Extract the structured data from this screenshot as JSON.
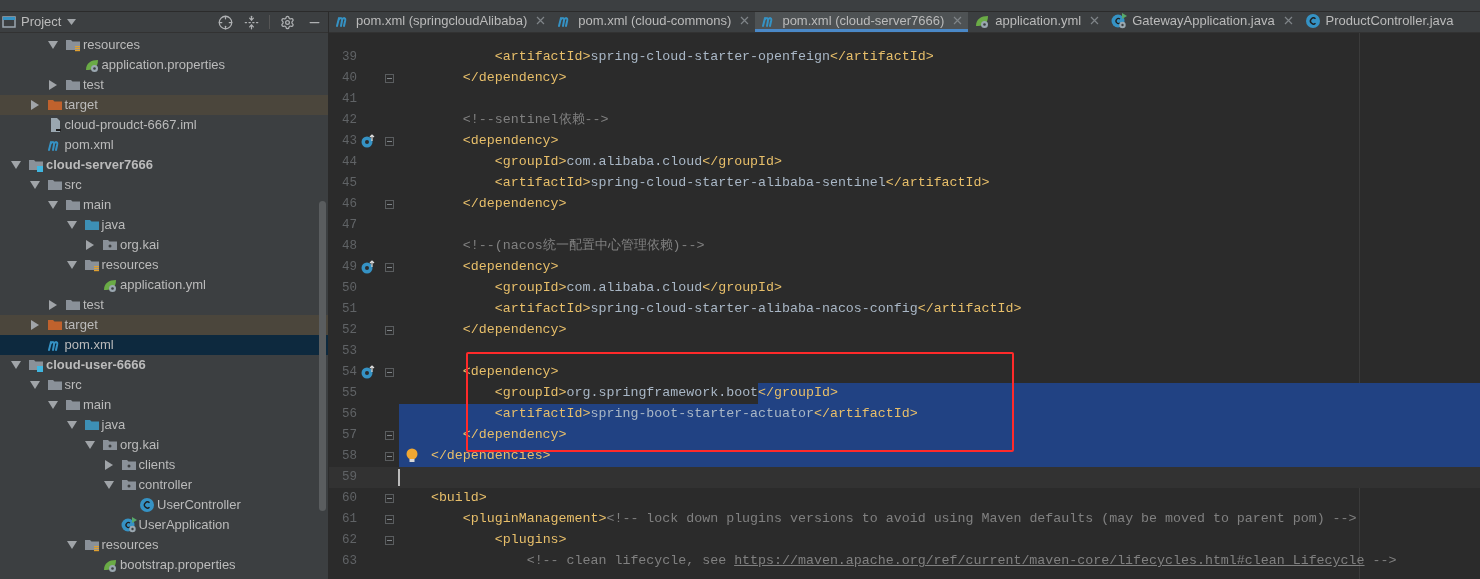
{
  "sidebar": {
    "title": "Project",
    "tree": [
      {
        "children": [
          {
            "children": [
              {
                "label": "resources",
                "kind": "resources-folder",
                "expanded": true,
                "selected": false,
                "children": [
                  {
                    "label": "application.properties",
                    "kind": "spring-config",
                    "selected": false
                  }
                ]
              },
              {
                "label": "test",
                "kind": "folder",
                "expanded": false,
                "selected": false
              }
            ]
          },
          {
            "label": "target",
            "kind": "excluded-folder",
            "expanded": false,
            "selected": false
          },
          {
            "label": "cloud-proudct-6667.iml",
            "kind": "iml-file",
            "selected": false
          },
          {
            "label": "pom.xml",
            "kind": "maven",
            "selected": false
          }
        ]
      },
      {
        "label": "cloud-server7666",
        "kind": "module",
        "expanded": true,
        "selected": false,
        "children": [
          {
            "label": "src",
            "kind": "folder",
            "expanded": true,
            "selected": false,
            "children": [
              {
                "label": "main",
                "kind": "folder",
                "expanded": true,
                "selected": false,
                "children": [
                  {
                    "label": "java",
                    "kind": "source-folder",
                    "expanded": true,
                    "selected": false,
                    "children": [
                      {
                        "label": "org.kai",
                        "kind": "package",
                        "expanded": false,
                        "selected": false
                      }
                    ]
                  },
                  {
                    "label": "resources",
                    "kind": "resources-folder",
                    "expanded": true,
                    "selected": false,
                    "children": [
                      {
                        "label": "application.yml",
                        "kind": "spring-config",
                        "selected": false
                      }
                    ]
                  }
                ]
              },
              {
                "label": "test",
                "kind": "folder",
                "expanded": false,
                "selected": false
              }
            ]
          },
          {
            "label": "target",
            "kind": "excluded-folder",
            "expanded": false,
            "selected": false
          },
          {
            "label": "pom.xml",
            "kind": "maven",
            "selected": true
          }
        ]
      },
      {
        "label": "cloud-user-6666",
        "kind": "module",
        "expanded": true,
        "selected": false,
        "children": [
          {
            "label": "src",
            "kind": "folder",
            "expanded": true,
            "selected": false,
            "children": [
              {
                "label": "main",
                "kind": "folder",
                "expanded": true,
                "selected": false,
                "children": [
                  {
                    "label": "java",
                    "kind": "source-folder",
                    "expanded": true,
                    "selected": false,
                    "children": [
                      {
                        "label": "org.kai",
                        "kind": "package",
                        "expanded": true,
                        "selected": false,
                        "children": [
                          {
                            "label": "clients",
                            "kind": "package",
                            "expanded": false,
                            "selected": false
                          },
                          {
                            "label": "controller",
                            "kind": "package",
                            "expanded": true,
                            "selected": false,
                            "children": [
                              {
                                "label": "UserController",
                                "kind": "class",
                                "selected": false
                              }
                            ]
                          },
                          {
                            "label": "UserApplication",
                            "kind": "boot-app",
                            "selected": false
                          }
                        ]
                      }
                    ]
                  },
                  {
                    "label": "resources",
                    "kind": "resources-folder",
                    "expanded": true,
                    "selected": false,
                    "children": [
                      {
                        "label": "bootstrap.properties",
                        "kind": "spring-config",
                        "selected": false
                      }
                    ]
                  }
                ]
              }
            ]
          }
        ]
      }
    ]
  },
  "tabs": [
    {
      "label": "pom.xml (springcloudAlibaba)",
      "kind": "maven",
      "selected": false,
      "closable": true
    },
    {
      "label": "pom.xml (cloud-commons)",
      "kind": "maven",
      "selected": false,
      "closable": true
    },
    {
      "label": "pom.xml (cloud-server7666)",
      "kind": "maven",
      "selected": true,
      "closable": true
    },
    {
      "label": "application.yml",
      "kind": "spring-config",
      "selected": false,
      "closable": true
    },
    {
      "label": "GatewayApplication.java",
      "kind": "boot-app",
      "selected": false,
      "closable": true
    },
    {
      "label": "ProductController.java",
      "kind": "class",
      "selected": false,
      "closable": false
    }
  ],
  "editor": {
    "lines": [
      {
        "number": "39",
        "text": "            <artifactId>spring-cloud-starter-openfeign</artifactId>"
      },
      {
        "number": "40",
        "text": "        </dependency>",
        "fold": true
      },
      {
        "number": "41"
      },
      {
        "number": "42",
        "text": "        <!--sentinel依赖-->"
      },
      {
        "number": "43",
        "text": "        <dependency>",
        "fold": true,
        "implemented": true
      },
      {
        "number": "44",
        "text": "            <groupId>com.alibaba.cloud</groupId>"
      },
      {
        "number": "45",
        "text": "            <artifactId>spring-cloud-starter-alibaba-sentinel</artifactId>"
      },
      {
        "number": "46",
        "text": "        </dependency>",
        "fold": true
      },
      {
        "number": "47"
      },
      {
        "number": "48",
        "text": "        <!--(nacos统一配置中心管理依赖)-->"
      },
      {
        "number": "49",
        "text": "        <dependency>",
        "fold": true,
        "implemented": true
      },
      {
        "number": "50",
        "text": "            <groupId>com.alibaba.cloud</groupId>"
      },
      {
        "number": "51",
        "text": "            <artifactId>spring-cloud-starter-alibaba-nacos-config</artifactId>"
      },
      {
        "number": "52",
        "text": "        </dependency>",
        "fold": true
      },
      {
        "number": "53"
      },
      {
        "number": "54",
        "text": "        <dependency>",
        "fold": true,
        "implemented": true
      },
      {
        "number": "55",
        "text": "            <groupId>org.springframework.boot",
        "selected_text": "</groupId>"
      },
      {
        "number": "56",
        "selected_text": "            <artifactId>spring-boot-starter-actuator</artifactId>"
      },
      {
        "number": "57",
        "selected_text": "        </dependency>",
        "fold": true
      },
      {
        "number": "58",
        "selected_text": "    </dependencies>",
        "fold": true,
        "bulb": true
      },
      {
        "number": "59",
        "current": true
      },
      {
        "number": "60",
        "text": "    <build>",
        "fold": true
      },
      {
        "number": "61",
        "text": "        <pluginManagement><!-- lock down plugins versions to avoid using Maven defaults (may be moved to parent pom) -->",
        "fold": true
      },
      {
        "number": "62",
        "text": "            <plugins>",
        "fold": true
      },
      {
        "number": "63",
        "text": "                <!-- clean lifecycle, see ",
        "link": "https://maven.apache.org/ref/current/maven-core/lifecycles.html#clean_Lifecycle",
        "text_after": " -->"
      }
    ]
  }
}
